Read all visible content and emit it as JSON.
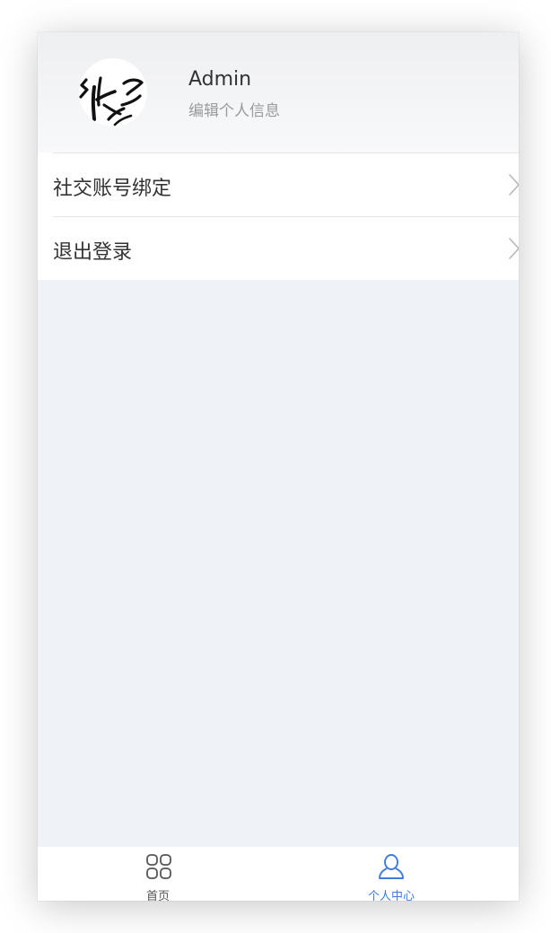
{
  "profile": {
    "name": "Admin",
    "subtitle": "编辑个人信息"
  },
  "menu": {
    "items": [
      {
        "label": "社交账号绑定",
        "icon": "chevron-right-icon"
      },
      {
        "label": "退出登录",
        "icon": "chevron-right-icon"
      }
    ]
  },
  "tabbar": {
    "tabs": [
      {
        "label": "首页",
        "icon": "grid-icon",
        "active": false
      },
      {
        "label": "个人中心",
        "icon": "user-icon",
        "active": true
      }
    ]
  },
  "colors": {
    "accent": "#3f7bd9",
    "page_background": "#eff2f6",
    "text_primary": "#333333",
    "text_secondary": "#9a9a9a"
  }
}
